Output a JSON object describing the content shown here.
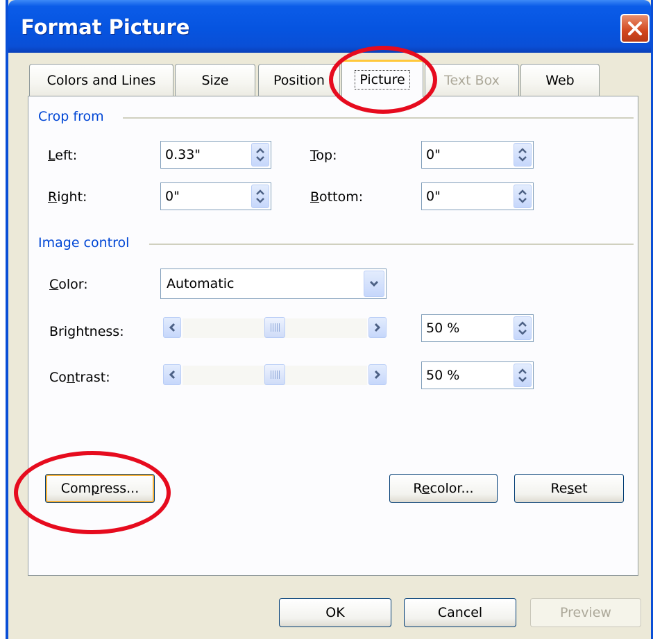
{
  "window": {
    "title": "Format Picture",
    "accent_color": "#0a4fd6",
    "close_icon": "close-icon"
  },
  "tabs": [
    {
      "label": "Colors and Lines",
      "state": "normal"
    },
    {
      "label": "Size",
      "state": "normal"
    },
    {
      "label": "Position",
      "state": "normal"
    },
    {
      "label": "Picture",
      "state": "active"
    },
    {
      "label": "Text Box",
      "state": "disabled"
    },
    {
      "label": "Web",
      "state": "normal"
    }
  ],
  "crop": {
    "group_label": "Crop from",
    "left_label_u": "L",
    "left_label_rest": "eft:",
    "left_value": "0.33\"",
    "top_label_u": "T",
    "top_label_rest": "op:",
    "top_value": "0\"",
    "right_label_u": "R",
    "right_label_rest": "ight:",
    "right_value": "0\"",
    "bottom_label_u": "B",
    "bottom_label_rest": "ottom:",
    "bottom_value": "0\""
  },
  "image_control": {
    "group_label": "Image control",
    "color_label_u": "C",
    "color_label_rest": "olor:",
    "color_value": "Automatic",
    "brightness_label_pre": "Bri",
    "brightness_label_u": "g",
    "brightness_label_post": "htness:",
    "brightness_value": "50 %",
    "brightness_level": 0.5,
    "contrast_label_pre": "Co",
    "contrast_label_u": "n",
    "contrast_label_post": "trast:",
    "contrast_value": "50 %",
    "contrast_level": 0.5
  },
  "buttons": {
    "compress_pre": "Com",
    "compress_u": "p",
    "compress_post": "ress...",
    "recolor_pre": "R",
    "recolor_u": "e",
    "recolor_post": "color...",
    "reset_pre": "Re",
    "reset_u": "s",
    "reset_post": "et",
    "ok": "OK",
    "cancel": "Cancel",
    "preview": "Preview"
  },
  "annotation_color": "#e60b1e"
}
